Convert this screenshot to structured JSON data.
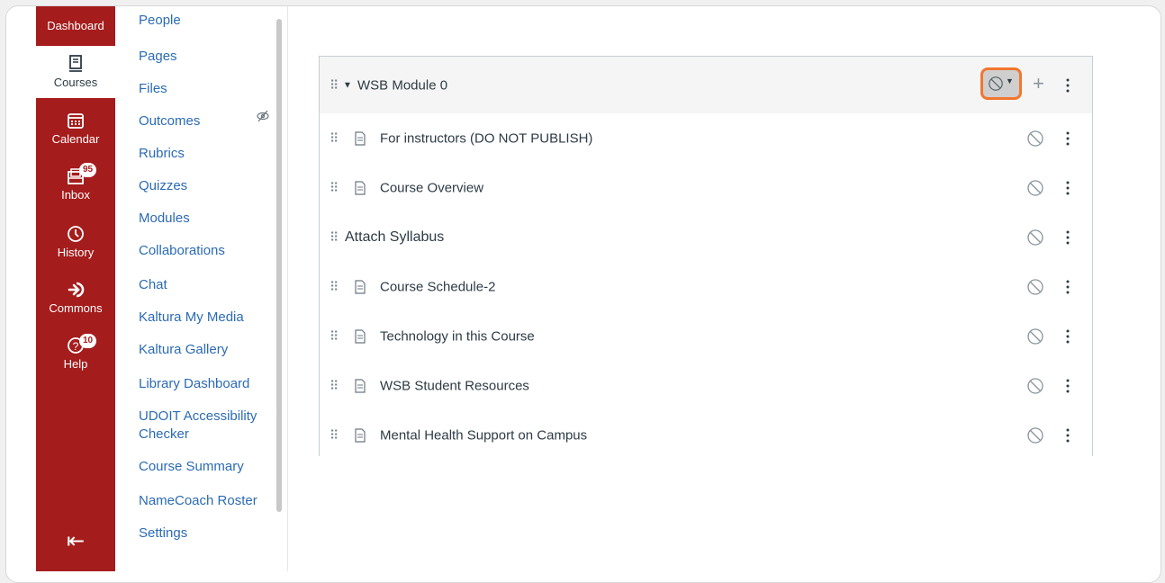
{
  "global_nav": {
    "dashboard": "Dashboard",
    "courses": "Courses",
    "calendar": "Calendar",
    "inbox": "Inbox",
    "inbox_badge": "95",
    "history": "History",
    "commons": "Commons",
    "help": "Help",
    "help_badge": "10"
  },
  "course_nav": [
    "People",
    "Pages",
    "Files",
    "Outcomes",
    "Rubrics",
    "Quizzes",
    "Modules",
    "Collaborations",
    "Chat",
    "Kaltura My Media",
    "Kaltura Gallery",
    "Library Dashboard",
    "UDOIT Accessibility",
    "Checker",
    "Course Summary",
    "NameCoach Roster",
    "Settings"
  ],
  "module": {
    "title": "WSB Module 0",
    "items": [
      {
        "title": "For instructors (DO NOT PUBLISH)",
        "type": "page"
      },
      {
        "title": "Course Overview",
        "type": "page"
      },
      {
        "title": "Attach Syllabus",
        "type": "subheader"
      },
      {
        "title": "Course Schedule-2",
        "type": "page"
      },
      {
        "title": "Technology in this Course",
        "type": "page"
      },
      {
        "title": "WSB Student Resources",
        "type": "page"
      },
      {
        "title": "Mental Health Support on Campus",
        "type": "page"
      }
    ]
  },
  "colors": {
    "nav_red": "#a51c1c",
    "link_blue": "#2b6bb5",
    "highlight": "#f2762e"
  }
}
